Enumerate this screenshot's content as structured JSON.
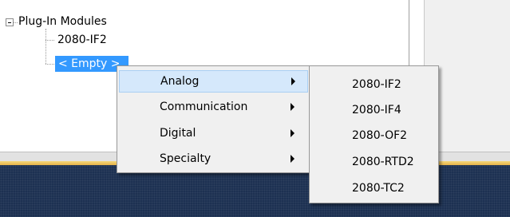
{
  "tree": {
    "root_label": "Plug-In Modules",
    "child_label": "2080-IF2",
    "selected_label": "< Empty >"
  },
  "context_menu": {
    "items": [
      {
        "label": "Analog",
        "highlighted": true
      },
      {
        "label": "Communication",
        "highlighted": false
      },
      {
        "label": "Digital",
        "highlighted": false
      },
      {
        "label": "Specialty",
        "highlighted": false
      }
    ]
  },
  "submenu": {
    "items": [
      {
        "label": "2080-IF2"
      },
      {
        "label": "2080-IF4"
      },
      {
        "label": "2080-OF2"
      },
      {
        "label": "2080-RTD2"
      },
      {
        "label": "2080-TC2"
      }
    ]
  },
  "colors": {
    "selection": "#3399ff",
    "menu_highlight": "#d5e8fb",
    "footer_band": "#1d3152",
    "footer_accent": "#e4b24a"
  }
}
